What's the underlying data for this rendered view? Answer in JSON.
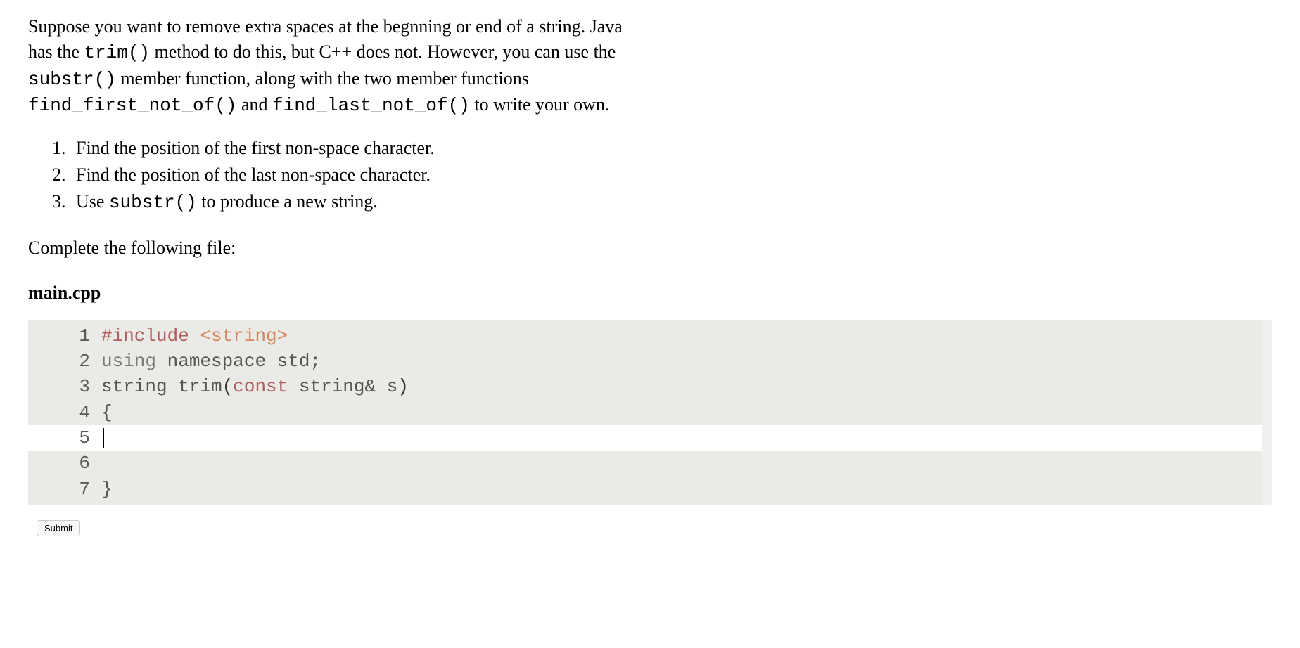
{
  "intro": {
    "part1": "Suppose you want to remove extra spaces at the begnning or end of a string. Java has the ",
    "code1": "trim()",
    "part2": " method to do this, but C++ does not. However, you can use the ",
    "code2": "substr()",
    "part3": " member function, along with the two member functions ",
    "code3": "find_first_not_of()",
    "part4": " and ",
    "code4": "find_last_not_of()",
    "part5": " to write your own."
  },
  "steps": {
    "item1": "Find the position of the first non-space character.",
    "item2": "Find the position of the last non-space character.",
    "item3_pre": "Use ",
    "item3_code": "substr()",
    "item3_post": " to produce a new string."
  },
  "complete_prompt": "Complete the following file:",
  "filename": "main.cpp",
  "code": {
    "line1": {
      "num": "1",
      "preprocessor": "#include",
      "header": " <string>"
    },
    "line2": {
      "num": "2",
      "keyword": "using",
      "rest": " namespace std;"
    },
    "line3": {
      "num": "3",
      "part1": "string trim",
      "paren_open": "(",
      "const_kw": "const",
      "part2": " string& s",
      "paren_close": ")"
    },
    "line4": {
      "num": "4",
      "content": "{"
    },
    "line5": {
      "num": "5",
      "content": ""
    },
    "line6": {
      "num": "6",
      "content": ""
    },
    "line7": {
      "num": "7",
      "content": "}"
    }
  },
  "submit_label": "Submit"
}
